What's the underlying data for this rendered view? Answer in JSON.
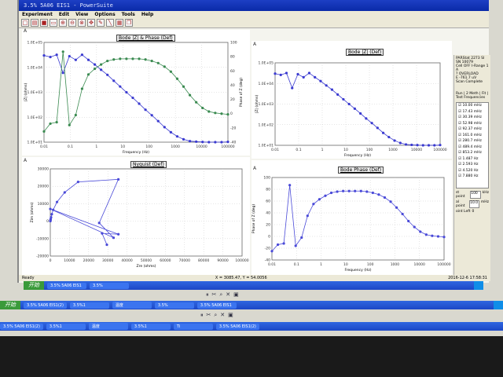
{
  "window": {
    "title": "3.5% 5A06 EIS1 - PowerSuite",
    "menu": [
      "Experiment",
      "Edit",
      "View",
      "Options",
      "Tools",
      "Help"
    ],
    "toolbar_icons": [
      "new-icon",
      "open-icon",
      "save-icon",
      "select-icon",
      "zoom-in-icon",
      "zoom-out-icon",
      "zoom-fit-icon",
      "pan-icon",
      "pen-icon",
      "line-icon",
      "color-icon",
      "copy-icon"
    ]
  },
  "panels": {
    "a_label": "A",
    "top_left_title": "Bode |Z| & Phase (Def)",
    "top_right_title": "Bode |Z| (Def)",
    "bottom_left_title": "Nyquist (Def)",
    "bottom_right_title": "Bode Phase (Def)"
  },
  "side": {
    "line1": "PARStat 2273 SI SN 10079",
    "line2": "Cell OFF  I-Range 1 A",
    "line3": "? OVERLOAD",
    "line4": "E -761.7 uV",
    "line5": "Scan Complete",
    "tabs": "Run | 2 Meth | Fit |",
    "list_title": "Test Frequencies",
    "freqs": [
      "10.00 mHz",
      "17.43 mHz",
      "30.39 mHz",
      "52.98 mHz",
      "92.37 mHz",
      "161.0 mHz",
      "280.7 mHz",
      "489.4 mHz",
      "853.2 mHz",
      "1.487 Hz",
      "2.593 Hz",
      "4.520 Hz",
      "7.880 Hz"
    ],
    "start_label": "st point",
    "start_value": "100",
    "start_unit": "kHz",
    "end_label": "al point",
    "end_value": "10.0",
    "end_unit": "mHz",
    "left_label": "oint Left",
    "left_value": "0"
  },
  "status": {
    "left": "Ready",
    "coords": "X = 3085.47, Y = 54.0056",
    "time": "2016-12-6 17:58:31"
  },
  "taskbars": [
    {
      "start": "开始",
      "items": [
        "3.5% 5A06 EIS1",
        "3.5%"
      ],
      "tray": "17:58"
    },
    {
      "start": "开始",
      "items": [
        "3.5% 5A06 EIS1(2)",
        "3.5%1",
        "温度",
        "3.5%",
        "3.5% 5A06 EIS1"
      ],
      "tray": ""
    },
    {
      "start": "",
      "items": [
        "3.5% 5A06 EIS1(2)",
        "3.5%1",
        "温度",
        "3.5%1",
        "Ti",
        "3.5% 5A06 EIS1(2)"
      ],
      "tray": ""
    }
  ],
  "chart_data": [
    {
      "type": "line",
      "title": "Bode |Z| & Phase (Def)",
      "xlabel": "Frequency (Hz)",
      "ylabel": "|Z| (ohms)",
      "y2label": "Phase of Z (deg)",
      "xscale": "log",
      "yscale": "log",
      "xlim": [
        0.01,
        100000
      ],
      "ylim": [
        10,
        100000
      ],
      "y2lim": [
        -40,
        100
      ],
      "grid": true,
      "x_ticks": [
        "0.01",
        "0.1",
        "1",
        "10",
        "100",
        "1000",
        "10000",
        "100000"
      ],
      "y_ticks": [
        "1.0E+01",
        "1.0E+02",
        "1.0E+03",
        "1.0E+04",
        "1.0E+05"
      ],
      "y2_ticks": [
        "-40",
        "-20",
        "0",
        "20",
        "40",
        "60",
        "80",
        "100"
      ],
      "series": [
        {
          "axis": "left",
          "color": "#3a3ad0"
        },
        {
          "axis": "right",
          "color": "#3a8a50"
        }
      ]
    },
    {
      "type": "line",
      "title": "Bode |Z| (Def)",
      "xlabel": "Frequency (Hz)",
      "ylabel": "|Z| (ohms)",
      "xscale": "log",
      "yscale": "log",
      "xlim": [
        0.01,
        100000
      ],
      "ylim": [
        10,
        100000
      ],
      "grid": true,
      "x_ticks": [
        "0.01",
        "0.1",
        "1",
        "10",
        "100",
        "1000",
        "10000",
        "100000"
      ],
      "y_ticks": [
        "1.0E+01",
        "1.0E+02",
        "1.0E+03",
        "1.0E+04",
        "1.0E+05"
      ]
    },
    {
      "type": "scatter",
      "title": "Nyquist (Def)",
      "xlabel": "Zre (ohms)",
      "ylabel": "Zim (ohms)",
      "xlim": [
        0,
        100000
      ],
      "ylim": [
        -20000,
        30000
      ],
      "grid": true,
      "x_ticks": [
        "0",
        "10000",
        "20000",
        "30000",
        "40000",
        "50000",
        "60000",
        "70000",
        "80000",
        "90000",
        "100000"
      ],
      "y_ticks": [
        "-20000",
        "-10000",
        "0",
        "10000",
        "20000",
        "30000"
      ],
      "points": [
        [
          29500,
          -13500
        ],
        [
          27000,
          -7000
        ],
        [
          35500,
          -7500
        ],
        [
          0,
          7000
        ],
        [
          33000,
          -9500
        ],
        [
          25500,
          -1000
        ],
        [
          35500,
          24000
        ],
        [
          14500,
          22500
        ],
        [
          7500,
          16500
        ],
        [
          3500,
          11000
        ],
        [
          1500,
          6500
        ],
        [
          800,
          4000
        ],
        [
          400,
          2200
        ],
        [
          200,
          1200
        ],
        [
          100,
          600
        ],
        [
          50,
          300
        ],
        [
          20,
          100
        ],
        [
          10,
          40
        ]
      ]
    },
    {
      "type": "line",
      "title": "Bode Phase (Def)",
      "xlabel": "Frequency (Hz)",
      "ylabel": "Phase of Z (deg)",
      "xscale": "log",
      "xlim": [
        0.01,
        100000
      ],
      "ylim": [
        -40,
        100
      ],
      "grid": true,
      "x_ticks": [
        "0.01",
        "0.1",
        "1",
        "10",
        "100",
        "1000",
        "10000",
        "100000"
      ],
      "y_ticks": [
        "-40",
        "-20",
        "0",
        "20",
        "40",
        "60",
        "80",
        "100"
      ]
    }
  ],
  "bode_data": {
    "frequency_hz": [
      0.01,
      0.01743,
      0.03039,
      0.05298,
      0.09237,
      0.161,
      0.2807,
      0.4894,
      0.8532,
      1.487,
      2.593,
      4.52,
      7.88,
      13.74,
      23.95,
      41.75,
      72.79,
      126.9,
      221.2,
      385.7,
      672.4,
      1172,
      2044,
      3563,
      6212,
      10830,
      18880,
      32920,
      57390,
      100000
    ],
    "z_mod_ohms": [
      30000,
      26000,
      32000,
      6000,
      28000,
      20000,
      32000,
      20000,
      13000,
      8000,
      5000,
      2900,
      1700,
      1000,
      600,
      350,
      200,
      120,
      70,
      40,
      25,
      17,
      13,
      11,
      10.5,
      10.2,
      10,
      10,
      10,
      10.3
    ],
    "phase_deg": [
      -25,
      -14,
      -12,
      87,
      -16,
      -2,
      35,
      55,
      63,
      69,
      74,
      76,
      77,
      77,
      77,
      77,
      76,
      74,
      71,
      66,
      59,
      49,
      38,
      26,
      16,
      8,
      3,
      1,
      0,
      -1
    ]
  }
}
